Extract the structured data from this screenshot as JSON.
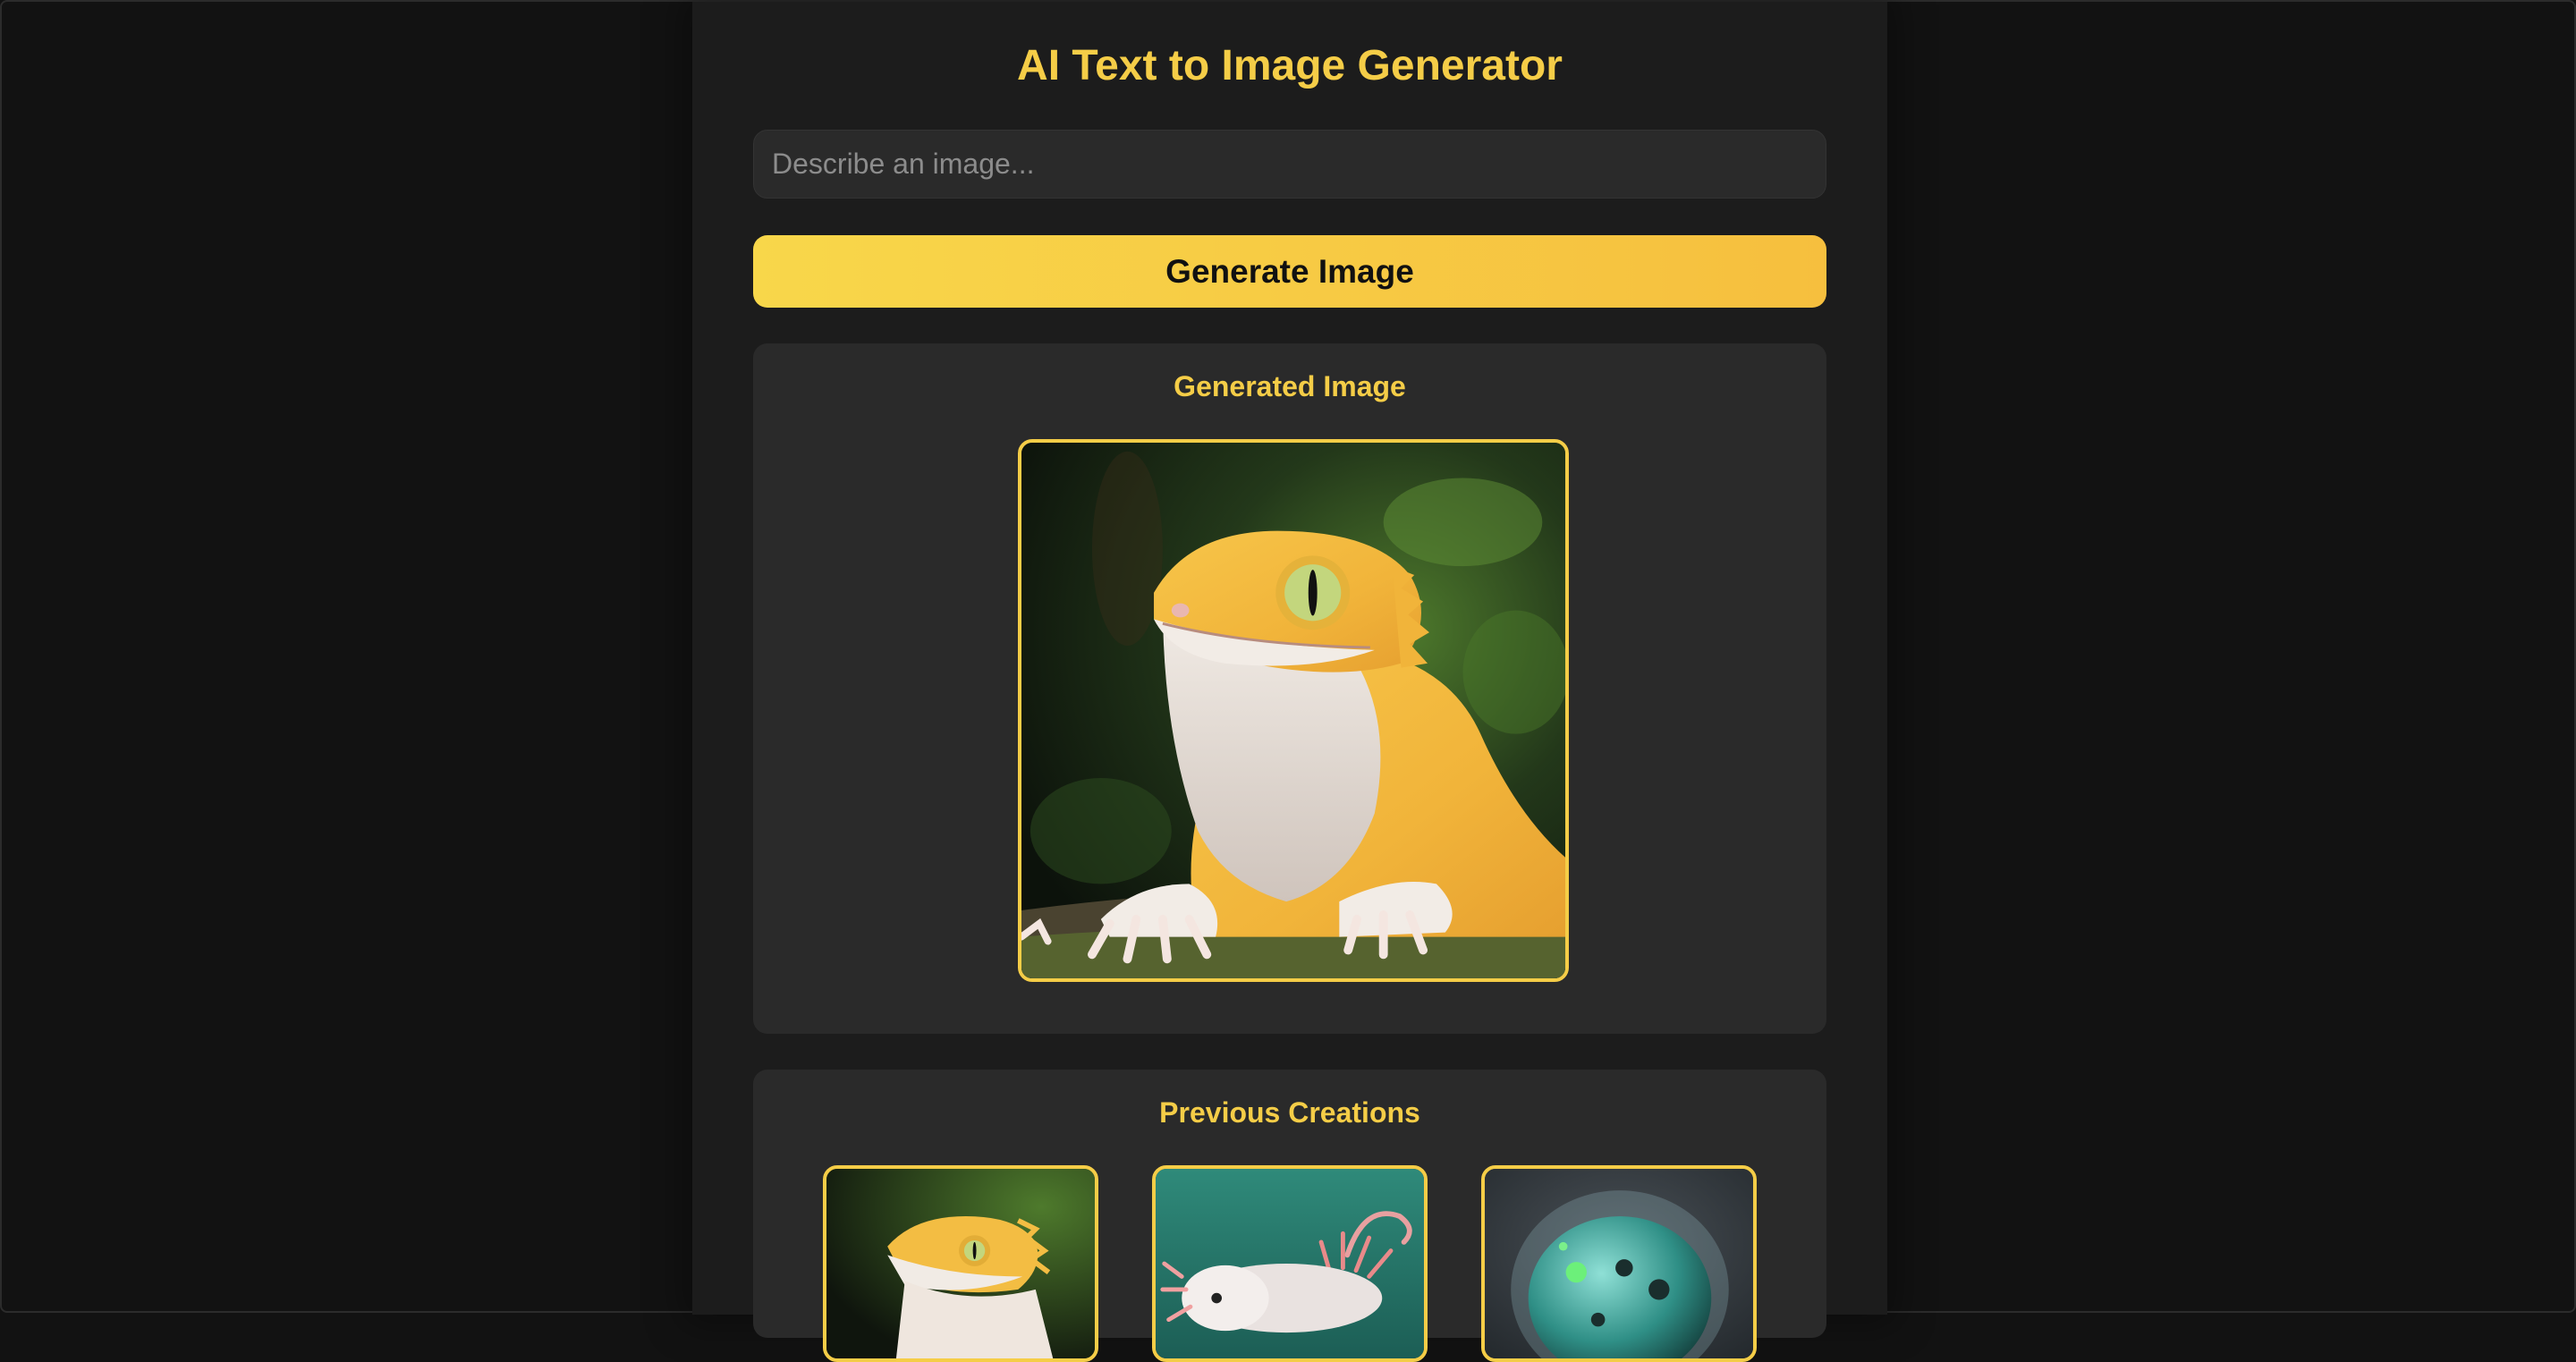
{
  "app": {
    "title": "AI Text to Image Generator"
  },
  "prompt": {
    "placeholder": "Describe an image...",
    "value": ""
  },
  "generate": {
    "label": "Generate Image"
  },
  "generated": {
    "heading": "Generated Image",
    "image_subject": "gecko-lizard"
  },
  "previous": {
    "heading": "Previous Creations",
    "items": [
      {
        "subject": "gecko-lizard"
      },
      {
        "subject": "axolotl"
      },
      {
        "subject": "jellyfish"
      }
    ]
  },
  "colors": {
    "accent": "#f5cd47",
    "button_gradient_start": "#f8d74a",
    "button_gradient_end": "#f6bf3e",
    "background": "#121212",
    "column": "#1c1c1c",
    "panel": "#2a2a2a"
  }
}
